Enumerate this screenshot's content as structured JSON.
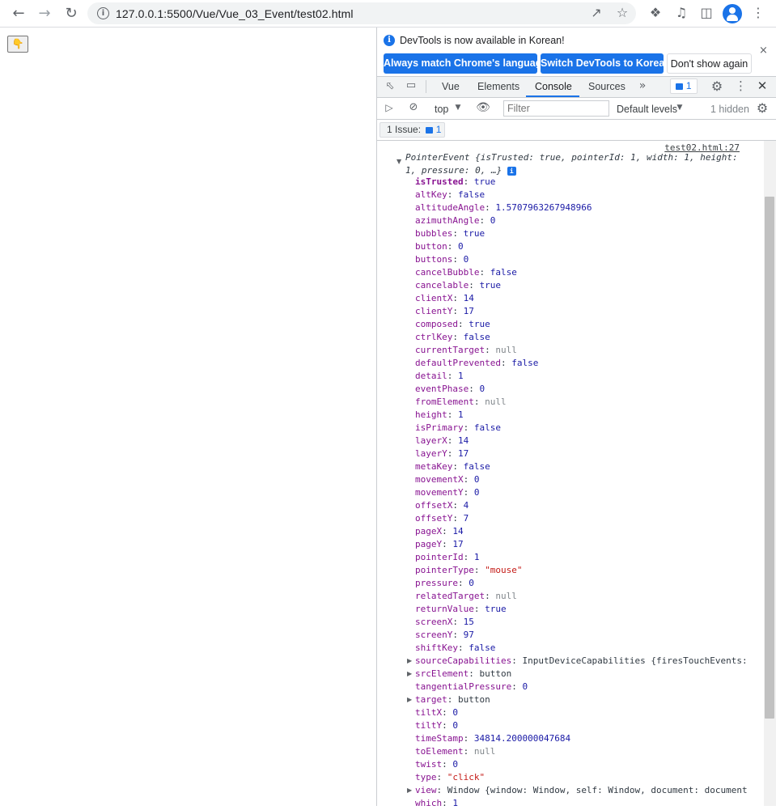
{
  "browser": {
    "url": "127.0.0.1:5500/Vue/Vue_03_Event/test02.html",
    "icons": [
      "back-icon",
      "forward-icon",
      "reload-icon",
      "site-info-icon",
      "share-icon",
      "bookmark-star-icon",
      "extensions-icon",
      "media-icon",
      "side-panel-icon",
      "profile-icon",
      "menu-icon"
    ]
  },
  "page": {
    "button_label": "👇"
  },
  "devtools": {
    "infobar": {
      "message": "DevTools is now available in Korean!",
      "btn_match": "Always match Chrome's language",
      "btn_switch": "Switch DevTools to Korean",
      "btn_dont_show": "Don't show again",
      "close": "×"
    },
    "tabs": [
      "Vue",
      "Elements",
      "Console",
      "Sources"
    ],
    "active_tab": "Console",
    "issues_count": "1",
    "console_toolbar": {
      "context": "top",
      "filter_placeholder": "Filter",
      "levels": "Default levels",
      "hidden": "1 hidden"
    },
    "issues_bar": {
      "label": "1 Issue:",
      "count": "1"
    },
    "source_link": "test02.html:27",
    "summary": "PointerEvent {isTrusted: true, pointerId: 1, width: 1, height: 1, pressure: 0, …}",
    "properties": [
      {
        "k": "isTrusted",
        "v": "true",
        "t": "bool",
        "own": true
      },
      {
        "k": "altKey",
        "v": "false",
        "t": "bool"
      },
      {
        "k": "altitudeAngle",
        "v": "1.5707963267948966",
        "t": "num"
      },
      {
        "k": "azimuthAngle",
        "v": "0",
        "t": "num"
      },
      {
        "k": "bubbles",
        "v": "true",
        "t": "bool"
      },
      {
        "k": "button",
        "v": "0",
        "t": "num"
      },
      {
        "k": "buttons",
        "v": "0",
        "t": "num"
      },
      {
        "k": "cancelBubble",
        "v": "false",
        "t": "bool"
      },
      {
        "k": "cancelable",
        "v": "true",
        "t": "bool"
      },
      {
        "k": "clientX",
        "v": "14",
        "t": "num"
      },
      {
        "k": "clientY",
        "v": "17",
        "t": "num"
      },
      {
        "k": "composed",
        "v": "true",
        "t": "bool"
      },
      {
        "k": "ctrlKey",
        "v": "false",
        "t": "bool"
      },
      {
        "k": "currentTarget",
        "v": "null",
        "t": "null"
      },
      {
        "k": "defaultPrevented",
        "v": "false",
        "t": "bool"
      },
      {
        "k": "detail",
        "v": "1",
        "t": "num"
      },
      {
        "k": "eventPhase",
        "v": "0",
        "t": "num"
      },
      {
        "k": "fromElement",
        "v": "null",
        "t": "null"
      },
      {
        "k": "height",
        "v": "1",
        "t": "num"
      },
      {
        "k": "isPrimary",
        "v": "false",
        "t": "bool"
      },
      {
        "k": "layerX",
        "v": "14",
        "t": "num"
      },
      {
        "k": "layerY",
        "v": "17",
        "t": "num"
      },
      {
        "k": "metaKey",
        "v": "false",
        "t": "bool"
      },
      {
        "k": "movementX",
        "v": "0",
        "t": "num"
      },
      {
        "k": "movementY",
        "v": "0",
        "t": "num"
      },
      {
        "k": "offsetX",
        "v": "4",
        "t": "num"
      },
      {
        "k": "offsetY",
        "v": "7",
        "t": "num"
      },
      {
        "k": "pageX",
        "v": "14",
        "t": "num"
      },
      {
        "k": "pageY",
        "v": "17",
        "t": "num"
      },
      {
        "k": "pointerId",
        "v": "1",
        "t": "num"
      },
      {
        "k": "pointerType",
        "v": "\"mouse\"",
        "t": "str"
      },
      {
        "k": "pressure",
        "v": "0",
        "t": "num"
      },
      {
        "k": "relatedTarget",
        "v": "null",
        "t": "null"
      },
      {
        "k": "returnValue",
        "v": "true",
        "t": "bool"
      },
      {
        "k": "screenX",
        "v": "15",
        "t": "num"
      },
      {
        "k": "screenY",
        "v": "97",
        "t": "num"
      },
      {
        "k": "shiftKey",
        "v": "false",
        "t": "bool"
      },
      {
        "k": "sourceCapabilities",
        "v": "InputDeviceCapabilities {firesTouchEvents:",
        "t": "obj",
        "expand": true
      },
      {
        "k": "srcElement",
        "v": "button",
        "t": "obj",
        "expand": true
      },
      {
        "k": "tangentialPressure",
        "v": "0",
        "t": "num"
      },
      {
        "k": "target",
        "v": "button",
        "t": "obj",
        "expand": true
      },
      {
        "k": "tiltX",
        "v": "0",
        "t": "num"
      },
      {
        "k": "tiltY",
        "v": "0",
        "t": "num"
      },
      {
        "k": "timeStamp",
        "v": "34814.200000047684",
        "t": "num"
      },
      {
        "k": "toElement",
        "v": "null",
        "t": "null"
      },
      {
        "k": "twist",
        "v": "0",
        "t": "num"
      },
      {
        "k": "type",
        "v": "\"click\"",
        "t": "str"
      },
      {
        "k": "view",
        "v": "Window {window: Window, self: Window, document: document",
        "t": "obj",
        "expand": true
      },
      {
        "k": "which",
        "v": "1",
        "t": "num"
      }
    ]
  }
}
